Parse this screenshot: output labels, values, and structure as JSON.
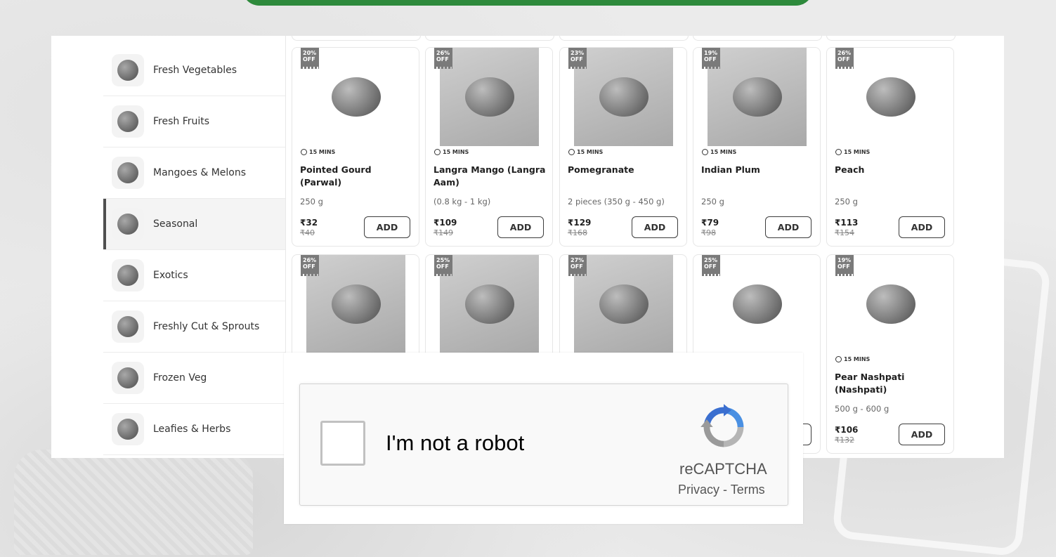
{
  "sidebar": {
    "items": [
      {
        "label": "Fresh Vegetables",
        "active": false
      },
      {
        "label": "Fresh Fruits",
        "active": false
      },
      {
        "label": "Mangoes & Melons",
        "active": false
      },
      {
        "label": "Seasonal",
        "active": true
      },
      {
        "label": "Exotics",
        "active": false
      },
      {
        "label": "Freshly Cut & Sprouts",
        "active": false
      },
      {
        "label": "Frozen Veg",
        "active": false
      },
      {
        "label": "Leafies & Herbs",
        "active": false
      }
    ]
  },
  "products": [
    {
      "discount": [
        "20%",
        "OFF"
      ],
      "eta": "15 MINS",
      "name": "Pointed Gourd (Parwal)",
      "qty": "250 g",
      "price": "₹32",
      "mrp": "₹40",
      "add": "ADD"
    },
    {
      "discount": [
        "26%",
        "OFF"
      ],
      "eta": "15 MINS",
      "name": "Langra Mango (Langra Aam)",
      "qty": "(0.8 kg - 1 kg)",
      "price": "₹109",
      "mrp": "₹149",
      "add": "ADD"
    },
    {
      "discount": [
        "23%",
        "OFF"
      ],
      "eta": "15 MINS",
      "name": "Pomegranate",
      "qty": "2 pieces (350 g - 450 g)",
      "price": "₹129",
      "mrp": "₹168",
      "add": "ADD"
    },
    {
      "discount": [
        "19%",
        "OFF"
      ],
      "eta": "15 MINS",
      "name": "Indian Plum",
      "qty": "250 g",
      "price": "₹79",
      "mrp": "₹98",
      "add": "ADD"
    },
    {
      "discount": [
        "26%",
        "OFF"
      ],
      "eta": "15 MINS",
      "name": "Peach",
      "qty": "250 g",
      "price": "₹113",
      "mrp": "₹154",
      "add": "ADD"
    },
    {
      "discount": [
        "26%",
        "OFF"
      ]
    },
    {
      "discount": [
        "25%",
        "OFF"
      ]
    },
    {
      "discount": [
        "27%",
        "OFF"
      ]
    },
    {
      "discount": [
        "25%",
        "OFF"
      ]
    },
    {
      "discount": [
        "19%",
        "OFF"
      ],
      "eta": "15 MINS",
      "name": "Pear Nashpati (Nashpati)",
      "qty": "500 g - 600 g",
      "price": "₹106",
      "mrp": "₹132",
      "add": "ADD"
    }
  ],
  "captcha": {
    "label": "I'm not a robot",
    "brand": "reCAPTCHA",
    "privacy": "Privacy",
    "separator": " - ",
    "terms": "Terms"
  },
  "colors": {
    "brand_green": "#2e8a3c"
  }
}
